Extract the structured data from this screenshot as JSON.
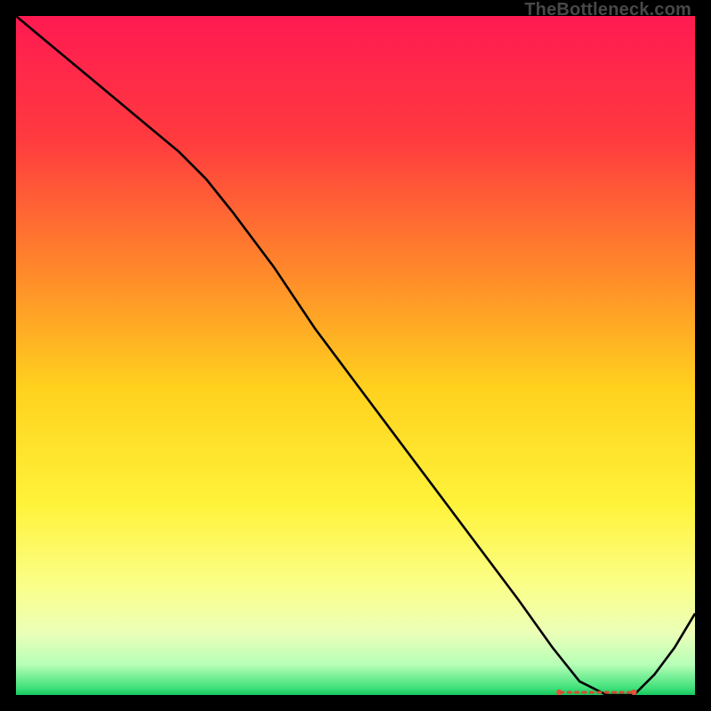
{
  "watermark": "TheBottleneck.com",
  "chart_data": {
    "type": "line",
    "title": "",
    "xlabel": "",
    "ylabel": "",
    "xlim": [
      0,
      100
    ],
    "ylim": [
      0,
      100
    ],
    "series": [
      {
        "name": "curve",
        "x": [
          0,
          6,
          12,
          18,
          24,
          28,
          32,
          38,
          44,
          50,
          56,
          62,
          68,
          74,
          79,
          83,
          87,
          91,
          94,
          97,
          100
        ],
        "y": [
          100,
          95,
          90,
          85,
          80,
          76,
          71,
          63,
          54,
          46,
          38,
          30,
          22,
          14,
          7,
          2,
          0,
          0,
          3,
          7,
          12
        ]
      }
    ],
    "flat_segment": {
      "x_start": 80,
      "x_end": 91,
      "y": 0
    },
    "gradient_stops": [
      {
        "offset": 0.0,
        "color": "#ff1a52"
      },
      {
        "offset": 0.18,
        "color": "#ff3a3f"
      },
      {
        "offset": 0.38,
        "color": "#ff8a2a"
      },
      {
        "offset": 0.55,
        "color": "#ffd21e"
      },
      {
        "offset": 0.72,
        "color": "#fff33a"
      },
      {
        "offset": 0.84,
        "color": "#fbff8a"
      },
      {
        "offset": 0.91,
        "color": "#eaffb8"
      },
      {
        "offset": 0.955,
        "color": "#b7ffb7"
      },
      {
        "offset": 0.99,
        "color": "#3fe07a"
      },
      {
        "offset": 1.0,
        "color": "#15c75d"
      }
    ]
  }
}
